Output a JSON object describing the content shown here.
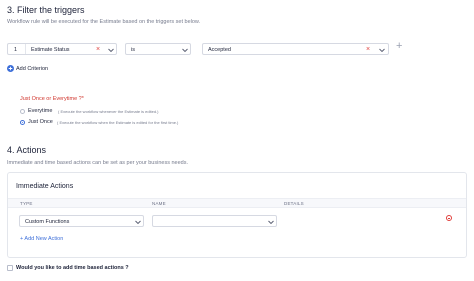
{
  "filter_section": {
    "title": "3. Filter the triggers",
    "description": "Workflow rule will be executed for the Estimate based on the triggers set below.",
    "criterion": {
      "index": "1",
      "field_value": "Estimate Status",
      "operator_value": "is",
      "value_value": "Accepted"
    },
    "add_criterion_label": "Add Criterion",
    "plus_glyph": "+",
    "remove_glyph": "×",
    "execution": {
      "label": "Just Once or Everytime ?",
      "required_mark": "*",
      "options": [
        {
          "label": "Everytime",
          "hint": "( Execute the workflow whenever the Estimate is edited.)",
          "selected": false
        },
        {
          "label": "Just Once",
          "hint": "( Execute the workflow when the Estimate is edited for the first time.)",
          "selected": true
        }
      ]
    }
  },
  "actions_section": {
    "title": "4. Actions",
    "description": "Immediate and time based actions can be set as per your business needs.",
    "immediate": {
      "title": "Immediate Actions",
      "columns": [
        "TYPE",
        "NAME",
        "DETAILS"
      ],
      "row": {
        "type_value": "Custom Functions",
        "name_value": ""
      },
      "add_action_label": "+ Add New Action",
      "remove_glyph": "−"
    },
    "time_based_checkbox_label": "Would you like to add time based actions ?"
  },
  "colors": {
    "accent": "#3d6fd9",
    "danger": "#e0403d",
    "required_label": "#d0342c",
    "muted": "#777c8e"
  },
  "icons": [
    "plus-circle-icon",
    "close-icon",
    "chevron-down-icon",
    "add-icon",
    "minus-circle-icon",
    "checkbox-icon"
  ]
}
